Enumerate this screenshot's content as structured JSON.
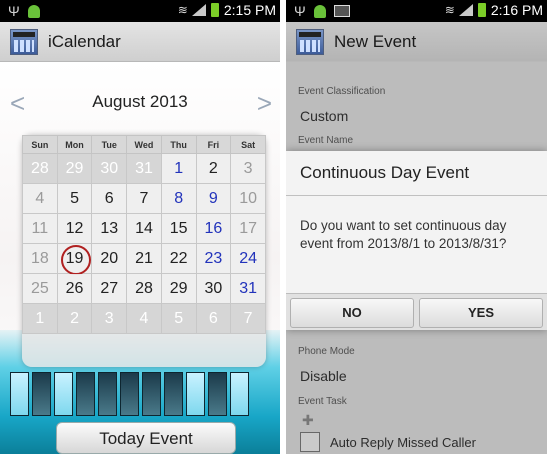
{
  "left": {
    "status": {
      "time": "2:15 PM"
    },
    "app_title": "iCalendar",
    "month": "August 2013",
    "weekdays": [
      "Sun",
      "Mon",
      "Tue",
      "Wed",
      "Thu",
      "Fri",
      "Sat"
    ],
    "weeks": [
      [
        "28",
        "29",
        "30",
        "31",
        "1",
        "2",
        "3"
      ],
      [
        "4",
        "5",
        "6",
        "7",
        "8",
        "9",
        "10"
      ],
      [
        "11",
        "12",
        "13",
        "14",
        "15",
        "16",
        "17"
      ],
      [
        "18",
        "19",
        "20",
        "21",
        "22",
        "23",
        "24"
      ],
      [
        "25",
        "26",
        "27",
        "28",
        "29",
        "30",
        "31"
      ],
      [
        "1",
        "2",
        "3",
        "4",
        "5",
        "6",
        "7"
      ]
    ],
    "selected_date": "19",
    "today_button": "Today Event"
  },
  "right": {
    "status": {
      "time": "2:16 PM"
    },
    "app_title": "New Event",
    "fields": {
      "classification_label": "Event Classification",
      "classification_value": "Custom",
      "name_label": "Event Name",
      "phone_mode_label": "Phone Mode",
      "phone_mode_value": "Disable",
      "task_label": "Event Task",
      "auto_reply_label": "Auto Reply Missed Caller"
    },
    "dialog": {
      "title": "Continuous Day Event",
      "message": "Do you want to set continuous day event from 2013/8/1 to 2013/8/31?",
      "no": "NO",
      "yes": "YES"
    }
  },
  "colors": {
    "accent_blue": "#2233bb",
    "today_ring": "#b02020",
    "battery": "#7ccd28"
  }
}
